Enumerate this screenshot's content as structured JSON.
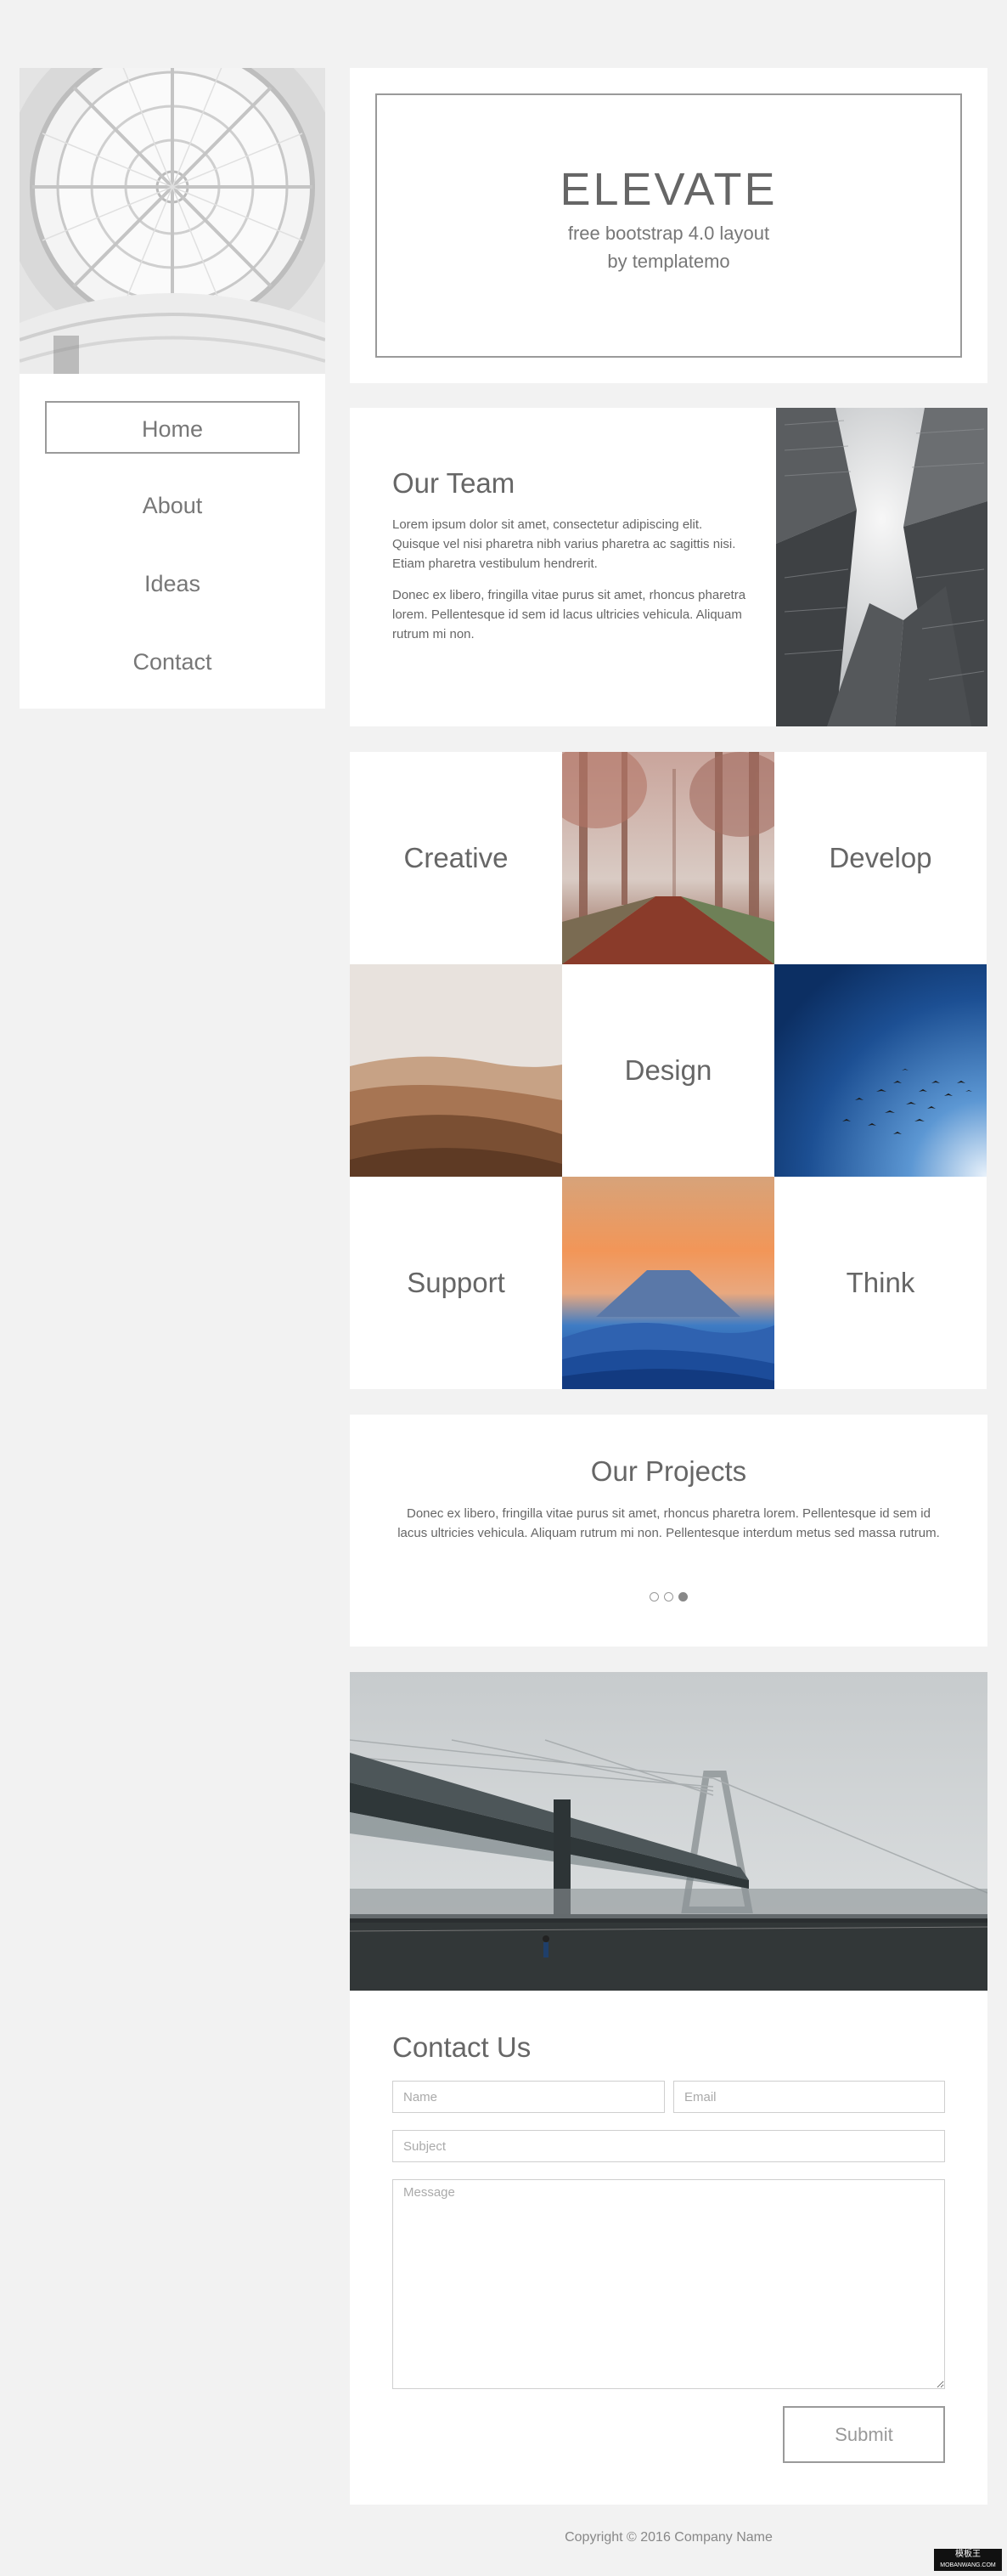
{
  "site": {
    "title": "ELEVATE",
    "subtitle_line1": "free bootstrap 4.0 layout",
    "subtitle_line2": "by templatemo"
  },
  "nav": {
    "items": [
      {
        "label": "Home",
        "active": true
      },
      {
        "label": "About",
        "active": false
      },
      {
        "label": "Ideas",
        "active": false
      },
      {
        "label": "Contact",
        "active": false
      }
    ]
  },
  "team": {
    "title": "Our Team",
    "para1": "Lorem ipsum dolor sit amet, consectetur adipiscing elit. Quisque vel nisi pharetra nibh varius pharetra ac sagittis nisi. Etiam pharetra vestibulum hendrerit.",
    "para2": "Donec ex libero, fringilla vitae purus sit amet, rhoncus pharetra lorem. Pellentesque id sem id lacus ultricies vehicula. Aliquam rutrum mi non."
  },
  "grid": {
    "creative": "Creative",
    "develop": "Develop",
    "design": "Design",
    "support": "Support",
    "think": "Think"
  },
  "projects": {
    "title": "Our Projects",
    "text": "Donec ex libero, fringilla vitae purus sit amet, rhoncus pharetra lorem. Pellentesque id sem id lacus ultricies vehicula. Aliquam rutrum mi non. Pellentesque interdum metus sed massa rutrum.",
    "active_slide": 3
  },
  "contact": {
    "title": "Contact Us",
    "name_placeholder": "Name",
    "email_placeholder": "Email",
    "subject_placeholder": "Subject",
    "message_placeholder": "Message",
    "submit_label": "Submit"
  },
  "footer": {
    "copyright": "Copyright © 2016 Company Name"
  },
  "badge": {
    "line1": "模板王",
    "line2": "MOBANWANG.COM"
  }
}
